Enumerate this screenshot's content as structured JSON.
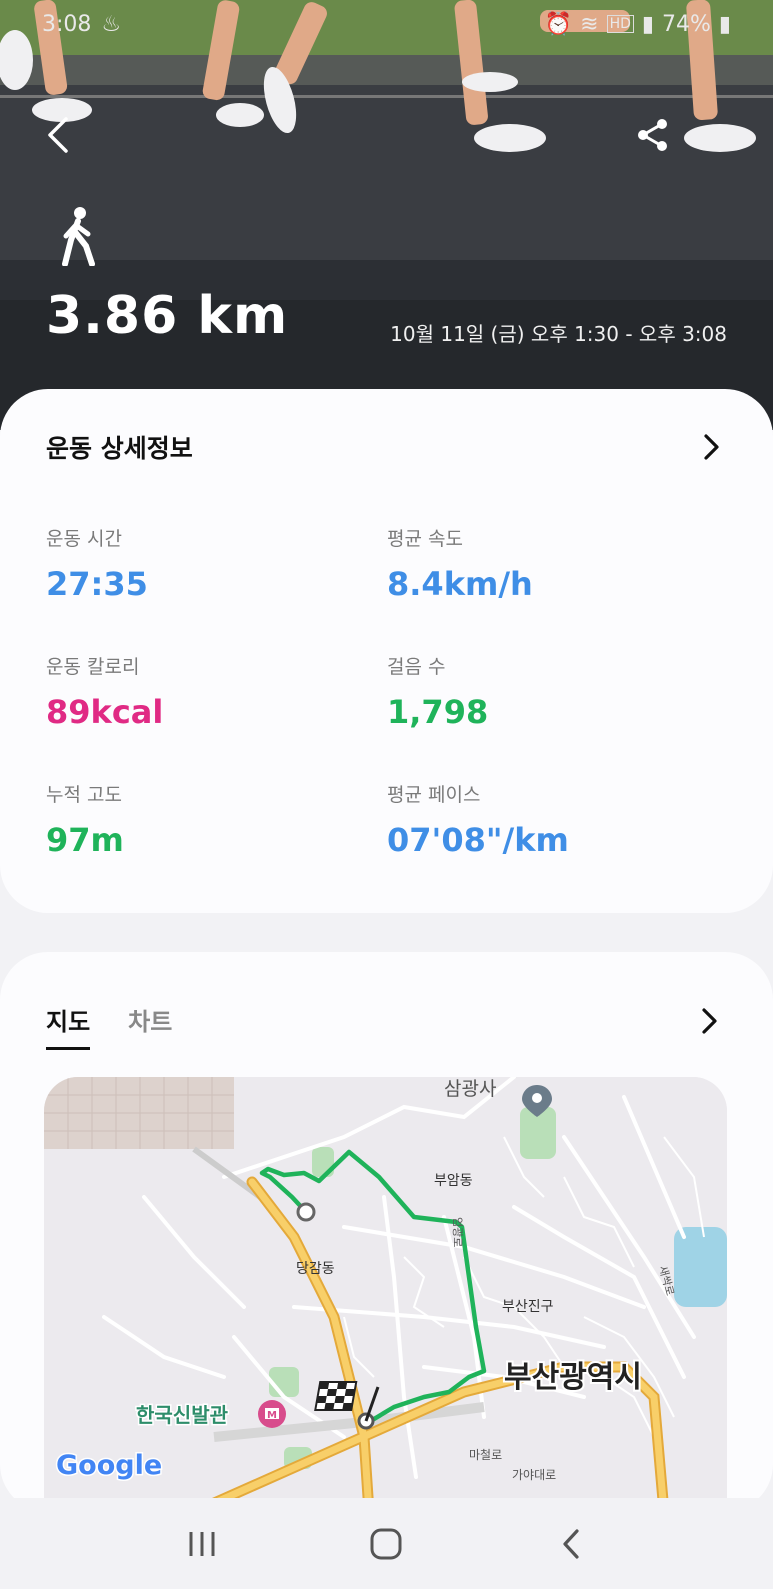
{
  "status": {
    "time": "3:08",
    "battery": "74%",
    "network": "HD"
  },
  "hero": {
    "activity_icon": "walk-icon",
    "distance": "3.86 km",
    "datetime": "10월 11일 (금) 오후 1:30 - 오후 3:08"
  },
  "details": {
    "title": "운동 상세정보",
    "stats": [
      {
        "label": "운동 시간",
        "value": "27:35",
        "color": "#3f8ee6"
      },
      {
        "label": "평균 속도",
        "value": "8.4km/h",
        "color": "#3f8ee6"
      },
      {
        "label": "운동 칼로리",
        "value": "89kcal",
        "color": "#e02a84"
      },
      {
        "label": "걸음 수",
        "value": "1,798",
        "color": "#1fb35a"
      },
      {
        "label": "누적 고도",
        "value": "97m",
        "color": "#1fb35a"
      },
      {
        "label": "평균 페이스",
        "value": "07'08\"/km",
        "color": "#3f8ee6"
      }
    ]
  },
  "map_section": {
    "tabs": [
      "지도",
      "차트"
    ],
    "active_tab": "지도",
    "labels": {
      "samgwangsa": "삼광사",
      "buamdong": "부암동",
      "danggamdong": "당감동",
      "busanjingu": "부산진구",
      "busan": "부산광역시",
      "museum": "한국신발관",
      "road1": "마철로",
      "road2": "가야대로",
      "road3": "엄광로",
      "road4": "새싹로",
      "google": "Google"
    }
  },
  "colors": {
    "route": "#1fb35a",
    "road": "#f6c04a",
    "blue_value": "#3f8ee6",
    "pink_value": "#e02a84",
    "green_value": "#1fb35a"
  }
}
